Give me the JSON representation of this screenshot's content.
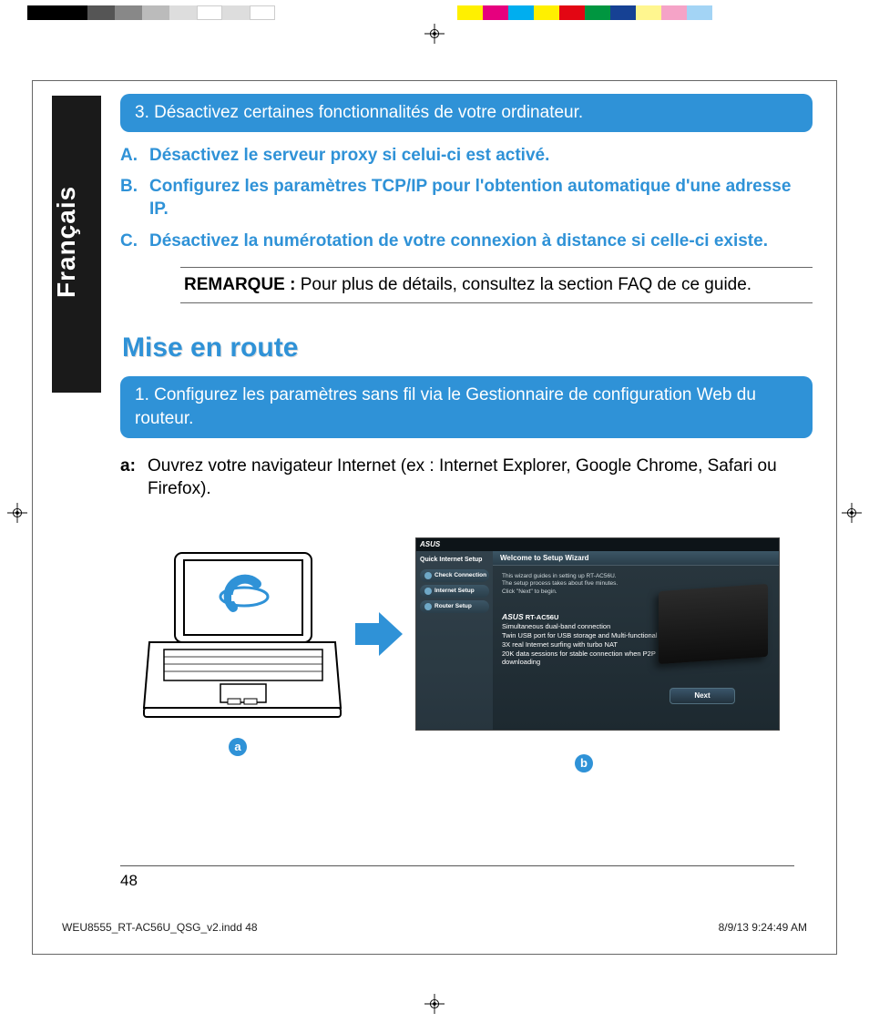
{
  "side_tab": "Français",
  "box3": "3.  Désactivez certaines fonctionnalités de votre ordinateur.",
  "steps": {
    "A": {
      "lbl": "A.",
      "text": "Désactivez le serveur proxy si celui-ci est activé."
    },
    "B": {
      "lbl": "B.",
      "text": "Configurez les paramètres TCP/IP pour l'obtention automatique d'une adresse IP."
    },
    "C": {
      "lbl": "C.",
      "text": "Désactivez la numérotation de votre connexion à distance si celle-ci existe."
    }
  },
  "note": {
    "label": "REMARQUE : ",
    "text": "Pour plus de détails, consultez la section FAQ de ce guide."
  },
  "section_title": "Mise en route",
  "box1": "1.  Configurez les paramètres sans fil via le Gestionnaire de configuration Web du routeur.",
  "substep_a": {
    "lbl": "a:",
    "text": "Ouvrez votre navigateur Internet (ex : Internet Explorer, Google Chrome, Safari ou Firefox)."
  },
  "badges": {
    "a": "a",
    "b": "b"
  },
  "wizard": {
    "brand": "ASUS",
    "sidebar_header": "Quick Internet Setup",
    "sidebar_items": [
      "Check Connection",
      "Internet Setup",
      "Router Setup"
    ],
    "main_header": "Welcome to Setup Wizard",
    "intro_lines": [
      "This wizard guides in setting up RT-AC56U.",
      "The setup process takes about five minutes.",
      "Click \"Next\" to begin."
    ],
    "product_brand": "ASUS",
    "product_model": "RT-AC56U",
    "product_desc": [
      "Simultaneous dual-band connection",
      "Twin USB port for USB storage and Multi-functional printer",
      "3X real Internet surfing with turbo NAT",
      "20K data sessions for stable connection when P2P",
      "downloading"
    ],
    "button": "Next"
  },
  "page_number": "48",
  "footer": {
    "left": "WEU8555_RT-AC56U_QSG_v2.indd   48",
    "right": "8/9/13   9:24:49 AM"
  }
}
